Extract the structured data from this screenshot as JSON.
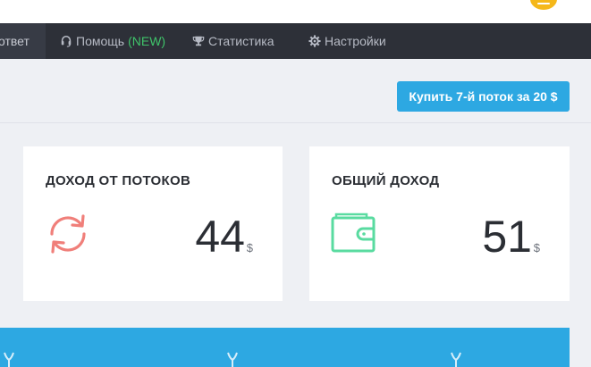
{
  "nav": {
    "items": [
      {
        "label": "ответ",
        "active": true,
        "icon": "none"
      },
      {
        "label": "Помощь",
        "badge": "(NEW)",
        "icon": "headset-icon"
      },
      {
        "label": "Статистика",
        "icon": "trophy-icon"
      },
      {
        "label": "Настройки",
        "icon": "gear-icon"
      }
    ]
  },
  "toolbar": {
    "buy_label": "Купить 7-й поток за 20 $"
  },
  "cards": [
    {
      "title": "ДОХОД ОТ ПОТОКОВ",
      "value": "44",
      "unit": "$",
      "icon": "refresh-icon",
      "color": "#f07f7a"
    },
    {
      "title": "ОБЩИЙ ДОХОД",
      "value": "51",
      "unit": "$",
      "icon": "wallet-icon",
      "color": "#59dba0"
    }
  ],
  "colors": {
    "accent": "#2da8e2",
    "navbar": "#2d3038",
    "badge": "#3fc36a",
    "avatar": "#f5b81a"
  }
}
